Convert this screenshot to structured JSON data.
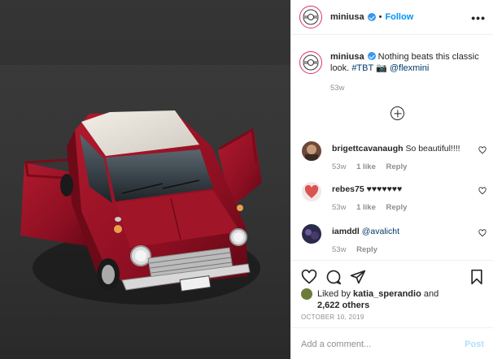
{
  "post": {
    "image_alt": "Red classic Mini with white roof and open doors on asphalt",
    "account": {
      "username": "miniusa",
      "follow_label": "Follow",
      "separator": "•",
      "more_label": "•••"
    },
    "caption": {
      "username": "miniusa",
      "text": "Nothing beats this classic look.",
      "hashtag": "#TBT",
      "camera_glyph": "📷",
      "mention": "@flexmini",
      "time": "53w"
    },
    "comments": [
      {
        "username": "brigettcavanaugh",
        "text": "So beautiful!!!!",
        "time": "53w",
        "likes": "1 like",
        "reply": "Reply"
      },
      {
        "username": "rebes75",
        "text": "♥♥♥♥♥♥♥",
        "time": "53w",
        "likes": "1 like",
        "reply": "Reply"
      },
      {
        "username": "iamddl",
        "text": "@avalicht",
        "time": "53w",
        "reply": "Reply"
      }
    ],
    "liked_by": {
      "prefix": "Liked by",
      "user": "katia_sperandio",
      "and": "and",
      "others": "2,622 others"
    },
    "date": "OCTOBER 10, 2019",
    "add_comment": {
      "placeholder": "Add a comment...",
      "post_label": "Post"
    },
    "colors": {
      "link": "#00376b",
      "follow": "#0095f6",
      "post_disabled": "#b2dffc",
      "car_red": "#9e1226"
    }
  }
}
